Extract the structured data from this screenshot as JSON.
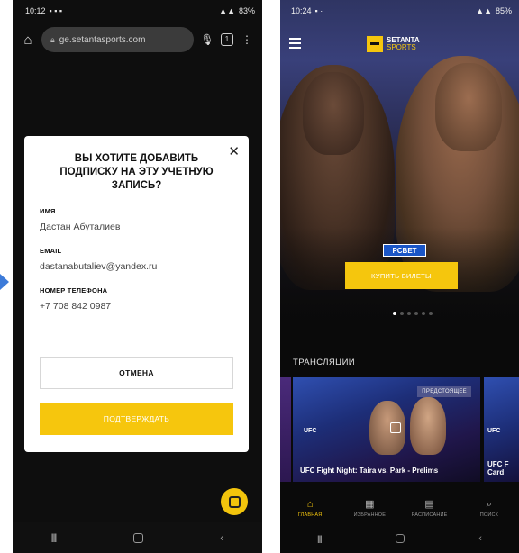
{
  "left": {
    "status": {
      "time": "10:12",
      "battery": "83%"
    },
    "browser": {
      "url": "ge.setantasports.com"
    },
    "dialog": {
      "title": "ВЫ ХОТИТЕ ДОБАВИТЬ ПОДПИСКУ НА ЭТУ УЧЕТНУЮ ЗАПИСЬ?",
      "fields": [
        {
          "label": "ИМЯ",
          "value": "Дастан Абуталиев"
        },
        {
          "label": "EMAIL",
          "value": "dastanabutaliev@yandex.ru"
        },
        {
          "label": "НОМЕР ТЕЛЕФОНА",
          "value": "+7 708 842 0987"
        }
      ],
      "cancel_label": "ОТМЕНА",
      "confirm_label": "ПОДТВЕРЖДАТЬ"
    }
  },
  "right": {
    "status": {
      "time": "10:24",
      "battery": "85%"
    },
    "brand": {
      "name": "SETANTA",
      "sub": "SPORTS"
    },
    "hero": {
      "partner": "PCBET",
      "cta_label": "КУПИТЬ БИЛЕТЫ"
    },
    "section_title": "ТРАНСЛЯЦИИ",
    "cards": [
      {
        "badge": "ПРЕДСТОЯЩЕЕ",
        "org": "UFC",
        "title": "UFC Fight Night: Taira vs. Park - Prelims"
      },
      {
        "org": "UFC",
        "title": "UFC F Card"
      }
    ],
    "tabs": [
      {
        "label": "ГЛАВНАЯ",
        "icon": "home-icon"
      },
      {
        "label": "ИЗБРАННОЕ",
        "icon": "grid-icon"
      },
      {
        "label": "РАСПИСАНИЕ",
        "icon": "calendar-icon"
      },
      {
        "label": "ПОИСК",
        "icon": "search-icon"
      }
    ]
  },
  "colors": {
    "accent": "#f5c60d",
    "partner": "#1a56c7",
    "arrow": "#3d7bd9"
  }
}
